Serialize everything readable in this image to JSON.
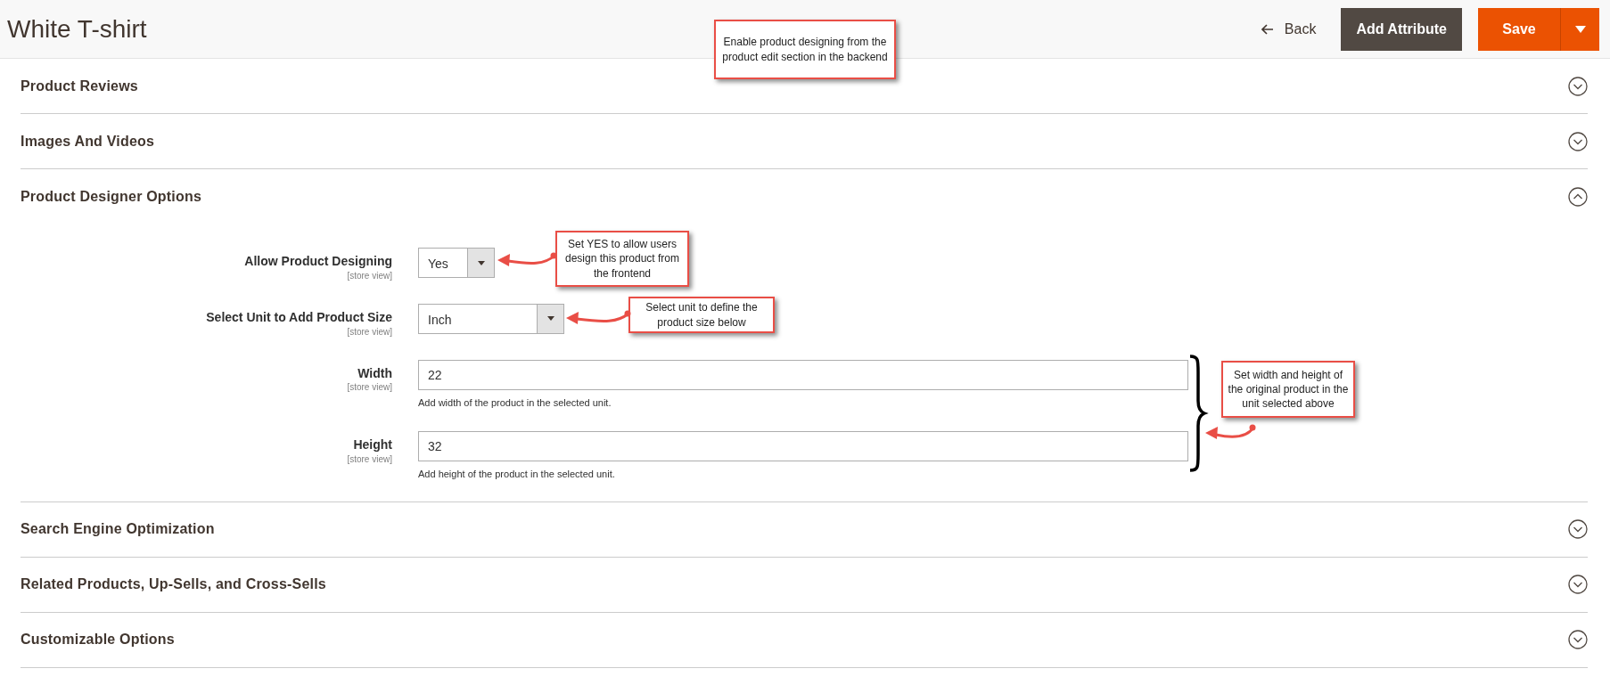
{
  "page": {
    "title": "White T-shirt"
  },
  "actions": {
    "back": "Back",
    "add_attribute": "Add Attribute",
    "save": "Save"
  },
  "sections": [
    {
      "title": "Product Reviews",
      "expanded": false
    },
    {
      "title": "Images And Videos",
      "expanded": false
    },
    {
      "title": "Product Designer Options",
      "expanded": true,
      "fields": [
        {
          "kind": "select",
          "label": "Allow Product Designing",
          "scope": "[store view]",
          "value": "Yes"
        },
        {
          "kind": "select",
          "label": "Select Unit to Add Product Size",
          "scope": "[store view]",
          "value": "Inch"
        },
        {
          "kind": "text",
          "label": "Width",
          "scope": "[store view]",
          "value": "22",
          "note": "Add width of the product in the selected unit."
        },
        {
          "kind": "text",
          "label": "Height",
          "scope": "[store view]",
          "value": "32",
          "note": "Add height of the product in the selected unit."
        }
      ]
    },
    {
      "title": "Search Engine Optimization",
      "expanded": false
    },
    {
      "title": "Related Products, Up-Sells, and Cross-Sells",
      "expanded": false
    },
    {
      "title": "Customizable Options",
      "expanded": false
    }
  ],
  "annotations": [
    {
      "text": "Enable product designing from the product edit section in the backend"
    },
    {
      "text": "Set YES to allow users design this product from the frontend"
    },
    {
      "text": "Select unit to define the product size below"
    },
    {
      "text": "Set width and height of the original product in the unit selected above"
    }
  ]
}
